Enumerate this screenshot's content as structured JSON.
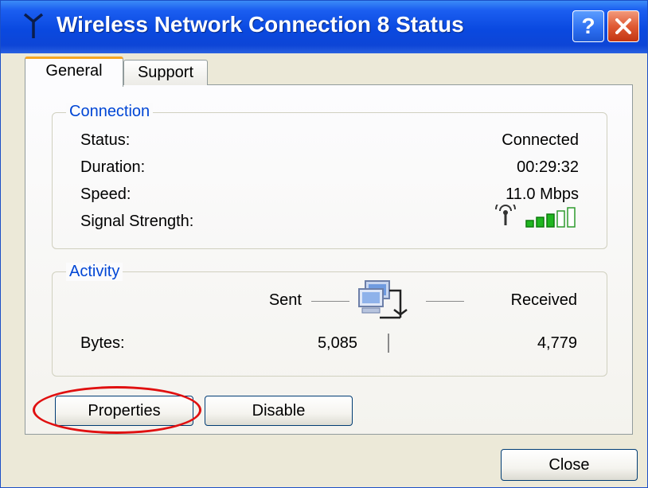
{
  "window": {
    "title": "Wireless Network Connection 8 Status",
    "title_icon": "wireless-antenna-icon",
    "help_label": "?",
    "accent_color": "#0a49e0",
    "close_button_color": "#e05a33"
  },
  "tabs": [
    {
      "label": "General",
      "selected": true
    },
    {
      "label": "Support",
      "selected": false
    }
  ],
  "connection": {
    "group_label": "Connection",
    "status_label": "Status:",
    "status_value": "Connected",
    "duration_label": "Duration:",
    "duration_value": "00:29:32",
    "speed_label": "Speed:",
    "speed_value": "11.0 Mbps",
    "signal_label": "Signal Strength:",
    "signal_icon": "signal-strength-icon",
    "signal_bars_filled": 3,
    "signal_bars_total": 5
  },
  "activity": {
    "group_label": "Activity",
    "sent_label": "Sent",
    "received_label": "Received",
    "bytes_label": "Bytes:",
    "bytes_sent": "5,085",
    "bytes_received": "4,779",
    "network_icon": "network-computers-icon"
  },
  "buttons": {
    "properties": "Properties",
    "disable": "Disable",
    "close": "Close"
  },
  "annotation": {
    "highlight_color": "#e01010",
    "highlight_target": "Properties"
  }
}
